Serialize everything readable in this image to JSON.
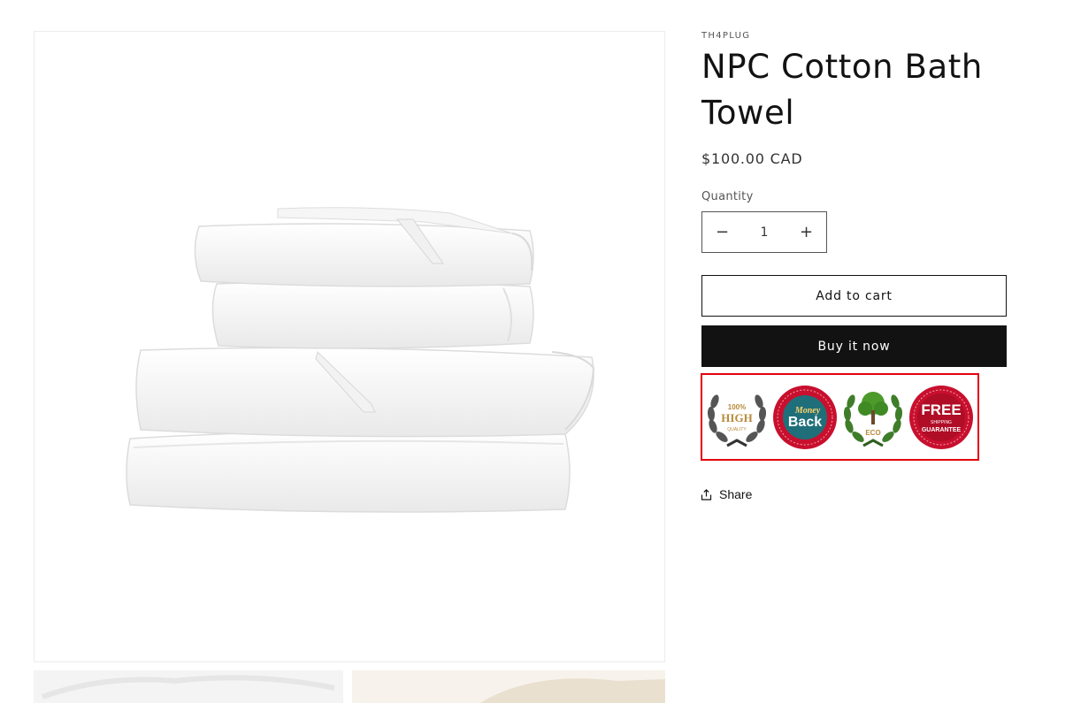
{
  "product": {
    "vendor": "TH4PLUG",
    "title": "NPC Cotton Bath Towel",
    "price": "$100.00 CAD",
    "quantity_label": "Quantity",
    "quantity_value": "1",
    "decrease_symbol": "−",
    "increase_symbol": "+",
    "add_to_cart_label": "Add to cart",
    "buy_now_label": "Buy it now",
    "share_label": "Share"
  },
  "badges": [
    {
      "icon": "high-quality-laurel-badge",
      "line1": "100%",
      "line2": "HIGH",
      "line3": "QUALITY"
    },
    {
      "icon": "money-back-seal-badge",
      "line1": "Money",
      "line2": "Back"
    },
    {
      "icon": "eco-tree-laurel-badge",
      "line1": "ECO"
    },
    {
      "icon": "free-shipping-seal-badge",
      "line1": "FREE",
      "line2": "SHIPPING",
      "line3": "GUARANTEE"
    }
  ],
  "colors": {
    "accent_dark": "#121212",
    "highlight_border": "#e3000f",
    "badge_red": "#c8102e",
    "badge_teal": "#1f6f7a",
    "badge_gold": "#b8893a",
    "badge_green": "#3f7d2a"
  }
}
